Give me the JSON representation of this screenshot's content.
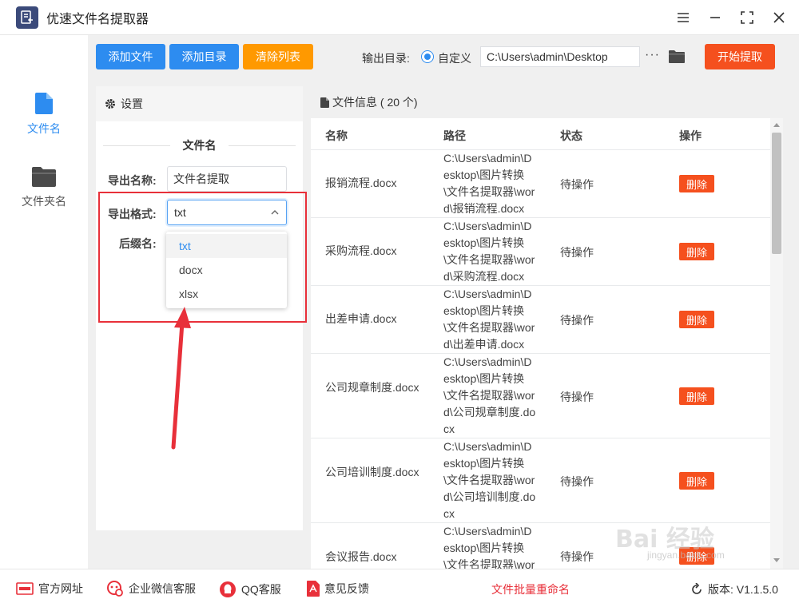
{
  "app": {
    "title": "优速文件名提取器"
  },
  "nav": {
    "items": [
      {
        "label": "文件名"
      },
      {
        "label": "文件夹名"
      }
    ]
  },
  "toolbar": {
    "add_file": "添加文件",
    "add_dir": "添加目录",
    "clear_list": "清除列表",
    "output_label": "输出目录:",
    "radio_label": "自定义",
    "output_path": "C:\\Users\\admin\\Desktop",
    "more": "···",
    "start": "开始提取"
  },
  "settings": {
    "title": "设置",
    "section_title": "文件名",
    "export_name_label": "导出名称:",
    "export_name_value": "文件名提取",
    "export_format_label": "导出格式:",
    "export_format_value": "txt",
    "suffix_label": "后缀名:",
    "format_options": [
      "txt",
      "docx",
      "xlsx"
    ]
  },
  "fileinfo": {
    "title": "文件信息 ( 20 个)",
    "columns": {
      "name": "名称",
      "path": "路径",
      "status": "状态",
      "action": "操作"
    },
    "rows": [
      {
        "name": "报销流程.docx",
        "path": "C:\\Users\\admin\\Desktop\\图片转换\\文件名提取器\\word\\报销流程.docx",
        "status": "待操作",
        "action": "删除"
      },
      {
        "name": "采购流程.docx",
        "path": "C:\\Users\\admin\\Desktop\\图片转换\\文件名提取器\\word\\采购流程.docx",
        "status": "待操作",
        "action": "删除"
      },
      {
        "name": "出差申请.docx",
        "path": "C:\\Users\\admin\\Desktop\\图片转换\\文件名提取器\\word\\出差申请.docx",
        "status": "待操作",
        "action": "删除"
      },
      {
        "name": "公司规章制度.docx",
        "path": "C:\\Users\\admin\\Desktop\\图片转换\\文件名提取器\\word\\公司规章制度.docx",
        "status": "待操作",
        "action": "删除"
      },
      {
        "name": "公司培训制度.docx",
        "path": "C:\\Users\\admin\\Desktop\\图片转换\\文件名提取器\\word\\公司培训制度.docx",
        "status": "待操作",
        "action": "删除"
      },
      {
        "name": "会议报告.docx",
        "path": "C:\\Users\\admin\\Desktop\\图片转换\\文件名提取器\\word\\会议报告.docx",
        "status": "待操作",
        "action": "删除"
      }
    ]
  },
  "footer": {
    "website": "官方网址",
    "wechat": "企业微信客服",
    "qq": "QQ客服",
    "feedback": "意见反馈",
    "rename": "文件批量重命名",
    "version": "版本: V1.1.5.0"
  },
  "watermark": {
    "brand": "Bai 经验",
    "url": "jingyan.baidu.com"
  },
  "colors": {
    "primary": "#2d8cf0",
    "warning": "#ff9900",
    "danger": "#f5501e",
    "highlight": "#e8303a"
  }
}
